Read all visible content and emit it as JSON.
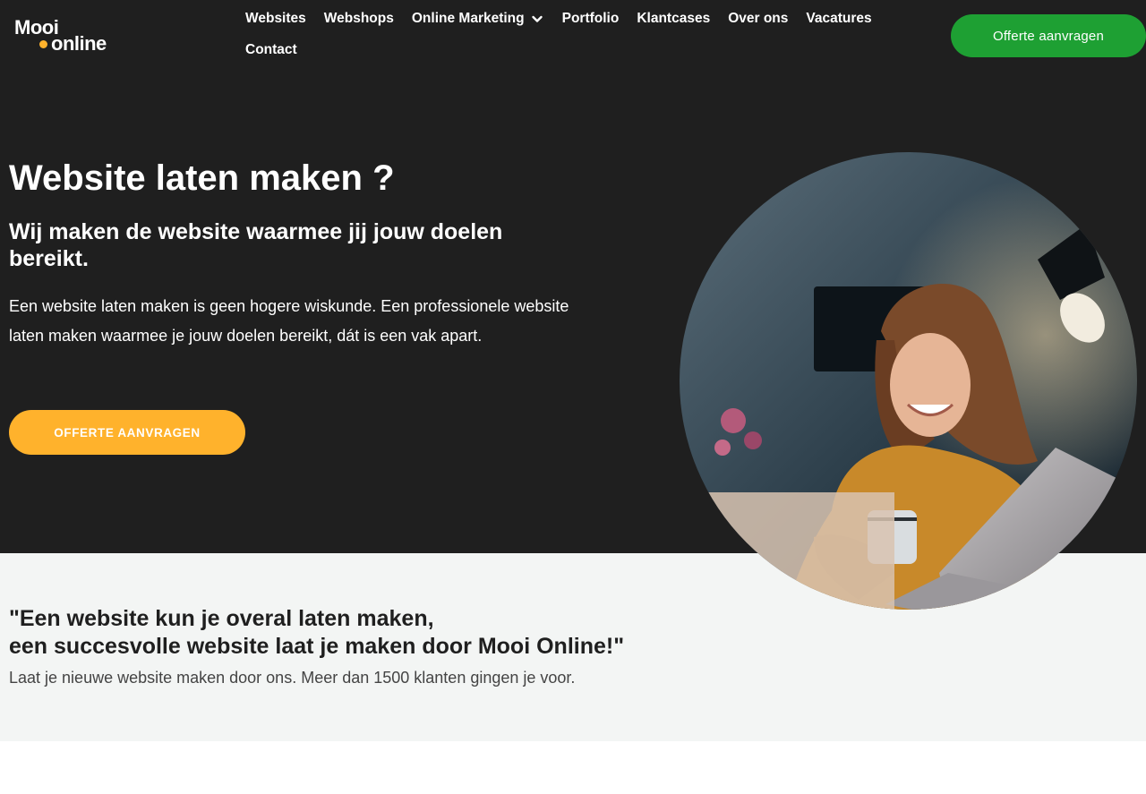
{
  "brand": {
    "logo_top": "Mooi",
    "logo_bottom": "online",
    "accent": "#ffb22c",
    "green": "#1ea033",
    "dark": "#1f1f1f",
    "band": "#f3f5f4"
  },
  "nav": {
    "row1": [
      "Websites",
      "Webshops",
      "Online Marketing",
      "Portfolio",
      "Klantcases",
      "Over ons",
      "Vacatures"
    ],
    "row2": [
      "Contact"
    ],
    "dropdown_icon": "chevron-down-icon",
    "cta_label": "Offerte aanvragen"
  },
  "hero": {
    "title": "Website laten maken ?",
    "subtitle": "Wij maken de website waarmee jij jouw doelen bereikt.",
    "intro": "Een website laten maken is geen hogere wiskunde. Een professionele website laten maken waarmee je jouw doelen bereikt, dát is een vak apart.",
    "cta_label": "OFFERTE AANVRAGEN"
  },
  "quote": {
    "line1": "\"Een website kun je overal laten maken,",
    "line2": "een succesvolle website laat je maken door Mooi Online!\"",
    "sub": "Laat je nieuwe website maken door ons. Meer dan 1500 klanten gingen je voor."
  }
}
